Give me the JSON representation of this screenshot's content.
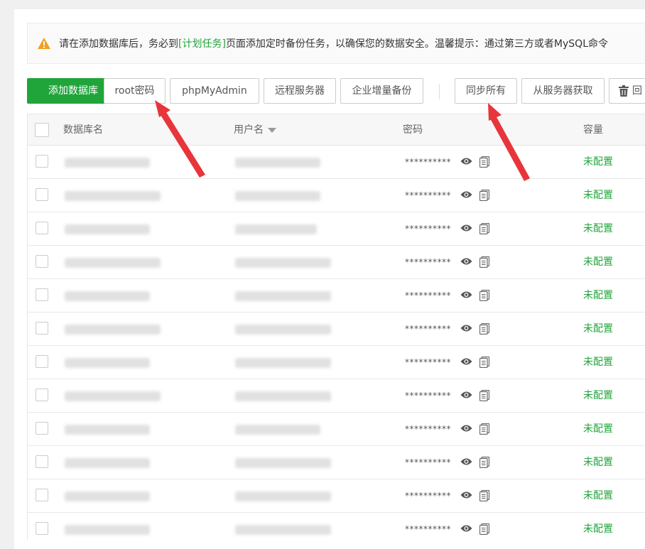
{
  "notice": {
    "prefix": "请在添加数据库后，务必到",
    "link": "[计划任务]",
    "suffix": "页面添加定时备份任务，以确保您的数据安全。温馨提示：通过第三方或者MySQL命令"
  },
  "toolbar": {
    "add_db": "添加数据库",
    "root_pw": "root密码",
    "phpmyadmin": "phpMyAdmin",
    "remote_server": "远程服务器",
    "enterprise_backup": "企业增量备份",
    "sync_all": "同步所有",
    "fetch_from_server": "从服务器获取",
    "recycle": "回"
  },
  "table": {
    "headers": {
      "db_name": "数据库名",
      "username": "用户名",
      "password": "密码",
      "capacity": "容量"
    },
    "rows": [
      {
        "password": "**********",
        "capacity": "未配置"
      },
      {
        "password": "**********",
        "capacity": "未配置"
      },
      {
        "password": "**********",
        "capacity": "未配置"
      },
      {
        "password": "**********",
        "capacity": "未配置"
      },
      {
        "password": "**********",
        "capacity": "未配置"
      },
      {
        "password": "**********",
        "capacity": "未配置"
      },
      {
        "password": "**********",
        "capacity": "未配置"
      },
      {
        "password": "**********",
        "capacity": "未配置"
      },
      {
        "password": "**********",
        "capacity": "未配置"
      },
      {
        "password": "**********",
        "capacity": "未配置"
      },
      {
        "password": "**********",
        "capacity": "未配置"
      },
      {
        "password": "**********",
        "capacity": "未配置"
      }
    ]
  },
  "colors": {
    "primary": "#20a53a",
    "warning": "#f0a020",
    "arrow": "#e8353b"
  }
}
